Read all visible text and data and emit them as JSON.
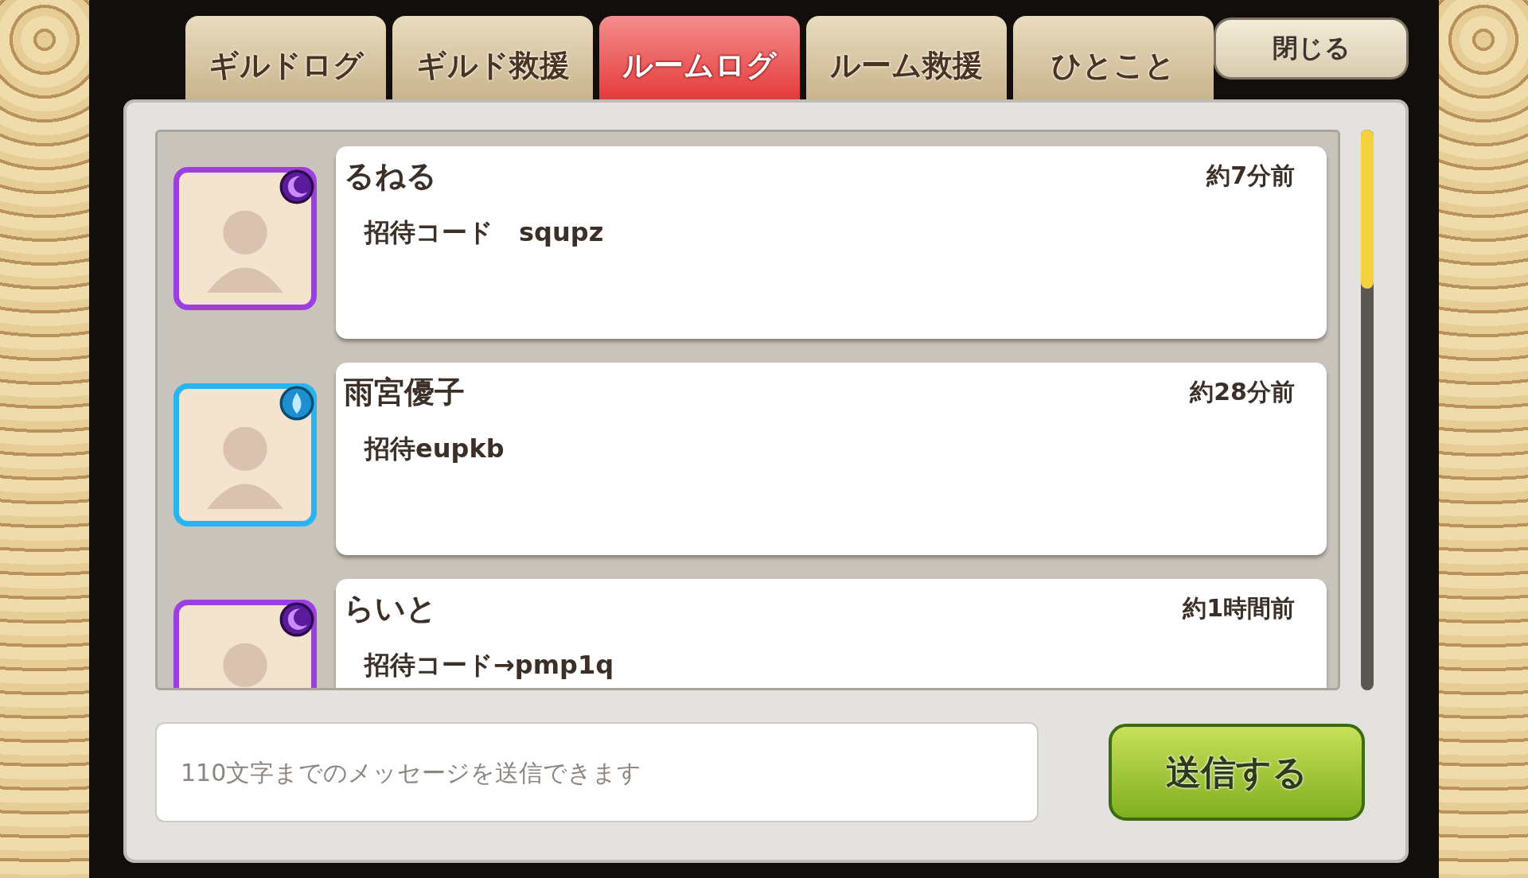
{
  "tabs": [
    {
      "label": "ギルドログ",
      "selected": false
    },
    {
      "label": "ギルド救援",
      "selected": false
    },
    {
      "label": "ルームログ",
      "selected": true
    },
    {
      "label": "ルーム救援",
      "selected": false
    },
    {
      "label": "ひとこと",
      "selected": false
    }
  ],
  "close_button": "閉じる",
  "messages": [
    {
      "name": "るねる",
      "time": "約7分前",
      "text": "招待コード　squpz",
      "color": "#9b3fe0",
      "kind": "moon"
    },
    {
      "name": "雨宮優子",
      "time": "約28分前",
      "text": "招待eupkb",
      "color": "#27b4ef",
      "kind": "water"
    },
    {
      "name": "らいと",
      "time": "約1時間前",
      "text": "招待コード→pmp1q",
      "color": "#9b3fe0",
      "kind": "moon"
    }
  ],
  "message_input": {
    "placeholder": "110文字までのメッセージを送信できます"
  },
  "send_button": "送信する"
}
